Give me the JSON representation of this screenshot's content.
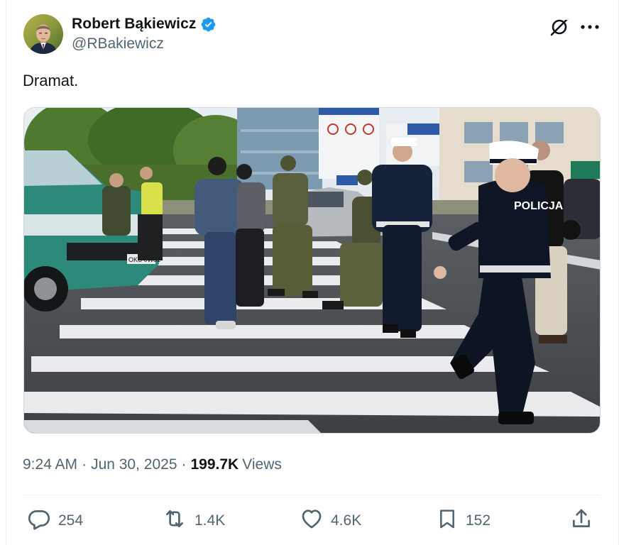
{
  "author": {
    "display_name": "Robert Bąkiewicz",
    "handle": "@RBakiewicz",
    "verified": true,
    "avatar_icon": "avatar-photo"
  },
  "header_icons": {
    "grok": "grok-icon",
    "more": "more-icon"
  },
  "tweet": {
    "text": "Dramat."
  },
  "media": {
    "kind": "video-frame",
    "police_label": "POLICJA",
    "plate_text": "OKS 0W81"
  },
  "meta": {
    "time": "9:24 AM",
    "separator": "·",
    "date": "Jun 30, 2025",
    "views_count": "199.7K",
    "views_label": "Views"
  },
  "actions": {
    "reply": {
      "icon": "reply-icon",
      "count": "254"
    },
    "repost": {
      "icon": "repost-icon",
      "count": "1.4K"
    },
    "like": {
      "icon": "like-icon",
      "count": "4.6K"
    },
    "bookmark": {
      "icon": "bookmark-icon",
      "count": "152"
    },
    "share": {
      "icon": "share-icon"
    }
  },
  "colors": {
    "text_primary": "#0f1419",
    "text_secondary": "#536471",
    "verified_blue": "#1d9bf0",
    "border": "#cfd9de"
  }
}
